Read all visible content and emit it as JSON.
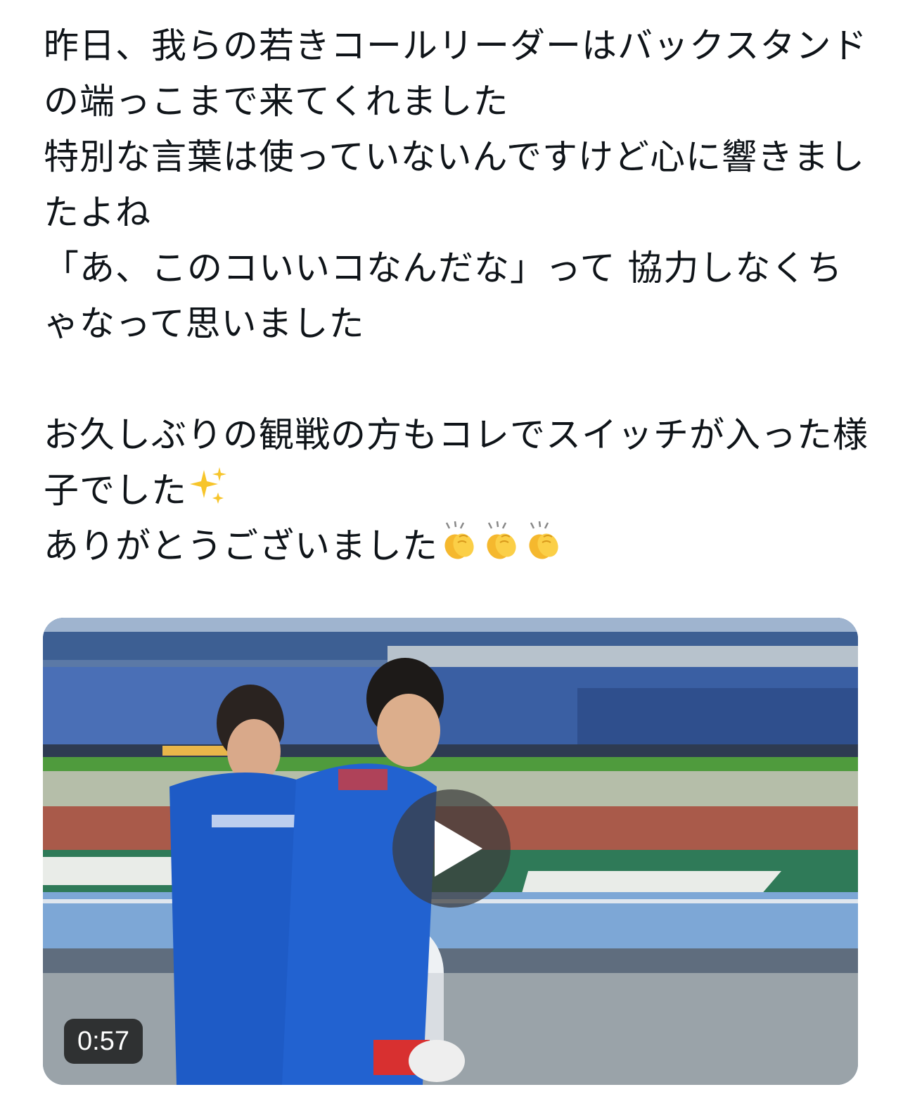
{
  "post": {
    "text_lines": [
      "昨日、我らの若きコールリーダーはバックスタンド",
      "の端っこまで来てくれました",
      "特別な言葉は使っていないんですけど心に響きまし",
      "たよね",
      "「あ、このコいいコなんだな」って 協力しなくち",
      "ゃなって思いました",
      "",
      "お久しぶりの観戦の方もコレでスイッチが入った様",
      "子でした",
      "ありがとうございました"
    ],
    "emojis": {
      "sparkles": "sparkles-emoji",
      "clap": "clapping-hands-emoji",
      "clap_count": 3
    }
  },
  "video": {
    "duration": "0:57",
    "play_icon": "play-icon"
  },
  "colors": {
    "text": "#0f1419",
    "background": "#ffffff",
    "badge_bg": "#141414",
    "badge_text": "#ffffff"
  }
}
